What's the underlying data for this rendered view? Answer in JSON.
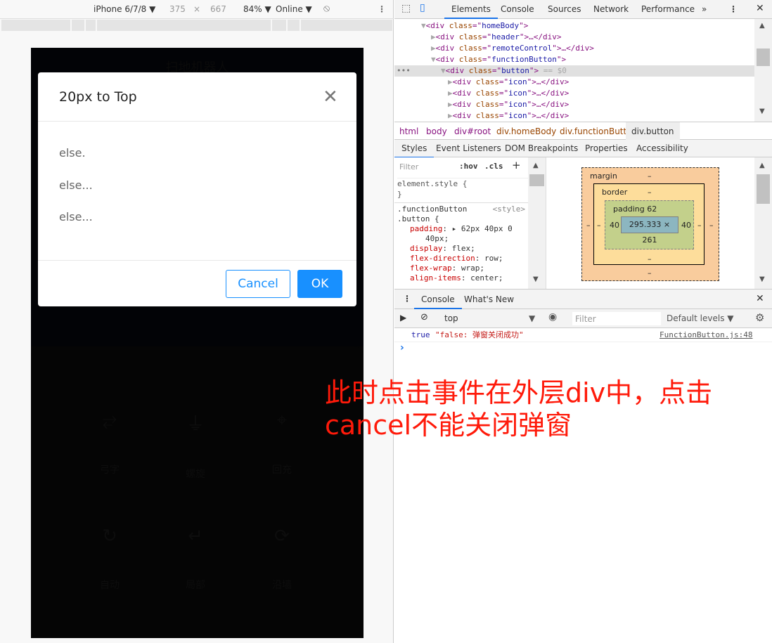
{
  "device_toolbar": {
    "device": "iPhone 6/7/8 ▼",
    "width": "375",
    "times": "×",
    "height": "667",
    "zoom": "84% ▼",
    "network": "Online ▼"
  },
  "phone": {
    "title": "扫地机器人",
    "functions": [
      {
        "label": "弓字",
        "icon": "zigzag-icon"
      },
      {
        "label": "螺旋",
        "icon": "plug-icon"
      },
      {
        "label": "回充",
        "icon": "target-icon"
      },
      {
        "label": "自动",
        "icon": "refresh-icon"
      },
      {
        "label": "局部",
        "icon": "return-icon"
      },
      {
        "label": "沿墙",
        "icon": "sync-icon"
      }
    ]
  },
  "modal": {
    "title": "20px to Top",
    "lines": [
      "else.",
      "else...",
      "else..."
    ],
    "cancel": "Cancel",
    "ok": "OK"
  },
  "devtools": {
    "tabs": [
      "Elements",
      "Console",
      "Sources",
      "Network",
      "Performance",
      "»"
    ],
    "tree": [
      {
        "tag": "div",
        "cls": "homeBody",
        "open": true,
        "end": ""
      },
      {
        "tag": "div",
        "cls": "header",
        "open": false,
        "end": "…</div>"
      },
      {
        "tag": "div",
        "cls": "remoteControl",
        "open": false,
        "end": "…</div>"
      },
      {
        "tag": "div",
        "cls": "functionButton",
        "open": true,
        "end": ""
      },
      {
        "tag": "div",
        "cls": "button",
        "open": true,
        "end": " == $0"
      },
      {
        "tag": "div",
        "cls": "icon",
        "open": false,
        "end": "…</div>"
      },
      {
        "tag": "div",
        "cls": "icon",
        "open": false,
        "end": "…</div>"
      },
      {
        "tag": "div",
        "cls": "icon",
        "open": false,
        "end": "…</div>"
      },
      {
        "tag": "div",
        "cls": "icon",
        "open": false,
        "end": "…</div>"
      }
    ],
    "breadcrumbs": [
      "html",
      "body",
      "div#root",
      "div.homeBody",
      "div.functionButton",
      "div.button"
    ],
    "styles_tabs": [
      "Styles",
      "Event Listeners",
      "DOM Breakpoints",
      "Properties",
      "Accessibility"
    ],
    "styles": {
      "filter_placeholder": "Filter",
      "hov": ":hov",
      "cls": ".cls",
      "element_style": "element.style {",
      "close": "}",
      "rule_selector1": ".functionButton",
      "rule_source": "<style>",
      "rule_selector2": ".button {",
      "props": [
        {
          "name": "padding",
          "value": "▸ 62px 40px 0"
        },
        {
          "name": "",
          "value": "40px;"
        },
        {
          "name": "display",
          "value": "flex;"
        },
        {
          "name": "flex-direction",
          "value": "row;"
        },
        {
          "name": "flex-wrap",
          "value": "wrap;"
        },
        {
          "name": "align-items",
          "value": "center;"
        }
      ]
    },
    "box_model": {
      "margin": "margin",
      "border": "border",
      "padding": "padding 62",
      "content": "295.333 × 261",
      "left": "40",
      "right": "40",
      "dash": "–"
    },
    "drawer_tabs": [
      "Console",
      "What's New"
    ],
    "console": {
      "context": "top",
      "filter_placeholder": "Filter",
      "levels": "Default levels ▼",
      "messages": [
        {
          "bool": "true",
          "text": "\"false: 弹窗关闭成功\"",
          "source": "FunctionButton.js:48"
        }
      ],
      "prompt": "›"
    }
  },
  "annotation": {
    "line1": "此时点击事件在外层div中，点击",
    "line2": "cancel不能关闭弹窗",
    "color": "#ff1a0a"
  }
}
